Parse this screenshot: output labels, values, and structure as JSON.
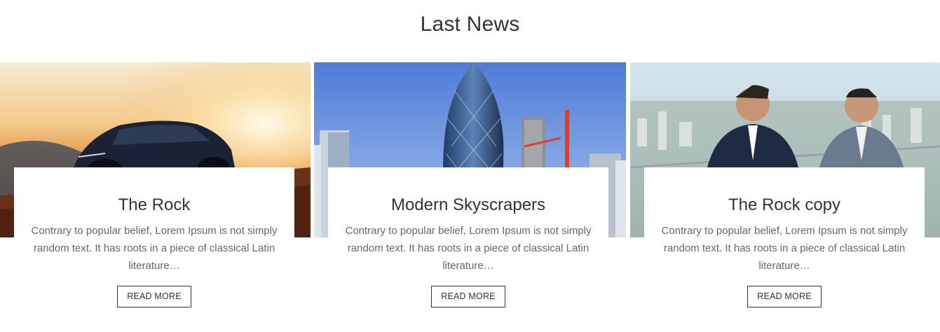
{
  "section": {
    "title": "Last News"
  },
  "posts": [
    {
      "title": "The Rock",
      "excerpt": "Contrary to popular belief, Lorem Ipsum is not simply random text. It has roots in a piece of classical Latin literature…",
      "button": "READ MORE",
      "image": "sports-car-sunset-photo"
    },
    {
      "title": "Modern Skyscrapers",
      "excerpt": "Contrary to popular belief, Lorem Ipsum is not simply random text. It has roots in a piece of classical Latin literature…",
      "button": "READ MORE",
      "image": "skyscrapers-photo"
    },
    {
      "title": "The Rock copy",
      "excerpt": "Contrary to popular belief, Lorem Ipsum is not simply random text. It has roots in a piece of classical Latin literature…",
      "button": "READ MORE",
      "image": "businessmen-rooftop-photo"
    }
  ],
  "colors": {
    "text": "#333333",
    "muted": "#666666",
    "background": "#ffffff"
  }
}
